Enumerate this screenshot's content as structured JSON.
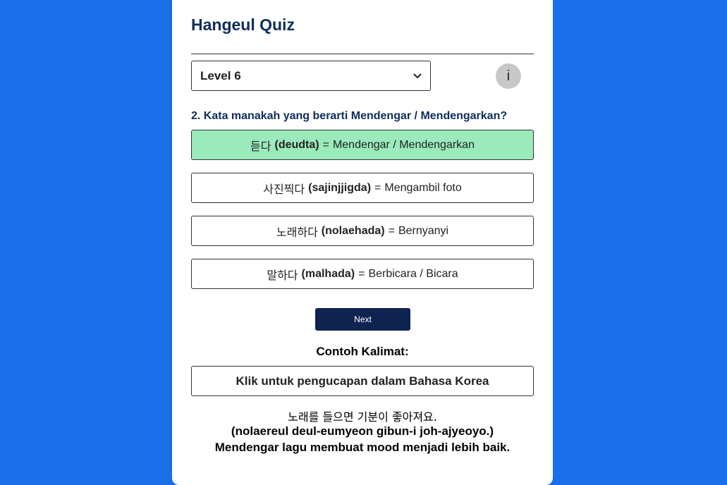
{
  "app": {
    "title": "Hangeul Quiz"
  },
  "level_select": {
    "selected": "Level 6"
  },
  "info_button": {
    "label": "i"
  },
  "question": {
    "text": "2. Kata manakah yang berarti Mendengar / Mendengarkan?"
  },
  "options": [
    {
      "korean": "듣다",
      "romanization": "(deudta)",
      "equals": "=",
      "meaning": "Mendengar / Mendengarkan",
      "state": "correct"
    },
    {
      "korean": "사진찍다",
      "romanization": "(sajinjjigda)",
      "equals": "=",
      "meaning": "Mengambil foto",
      "state": "default"
    },
    {
      "korean": "노래하다",
      "romanization": "(nolaehada)",
      "equals": "=",
      "meaning": "Bernyanyi",
      "state": "default"
    },
    {
      "korean": "말하다",
      "romanization": "(malhada)",
      "equals": "=",
      "meaning": "Berbicara / Bicara",
      "state": "default"
    }
  ],
  "next_button": {
    "label": "Next"
  },
  "example": {
    "heading": "Contoh Kalimat:",
    "pronunciation_button": "Klik untuk pengucapan dalam Bahasa Korea",
    "korean": "노래를 들으면 기분이 좋아져요.",
    "romanization": "(nolaereul deul-eumyeon gibun-i joh-ajyeoyo.)",
    "translation": "Mendengar lagu membuat mood menjadi lebih baik."
  },
  "colors": {
    "background": "#1a6ee8",
    "card": "#ffffff",
    "correct_option": "#9aeabc",
    "next_button": "#0f2350",
    "title_text": "#0f2d5c",
    "info_button": "#c8c8c8"
  },
  "icons": {
    "select_chevron": "chevron-down-icon"
  }
}
